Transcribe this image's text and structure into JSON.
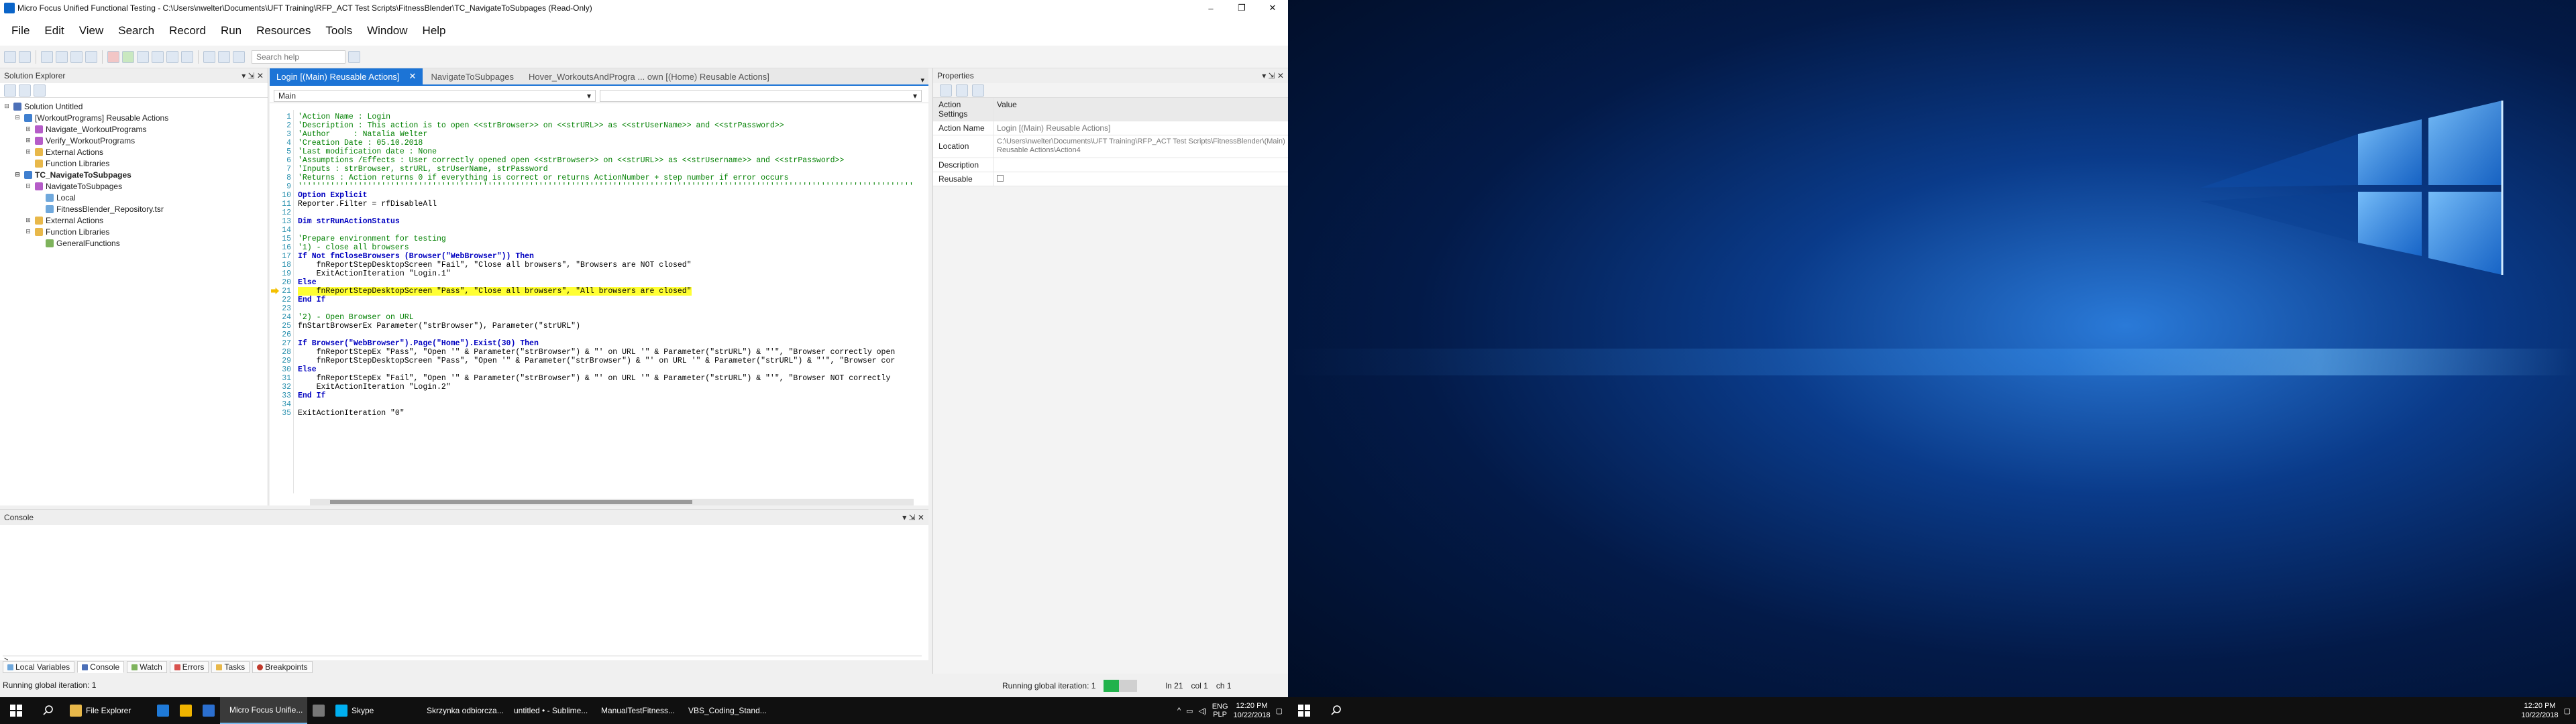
{
  "window": {
    "title": "Micro Focus Unified Functional Testing - C:\\Users\\nwelter\\Documents\\UFT Training\\RFP_ACT Test Scripts\\FitnessBlender\\TC_NavigateToSubpages (Read-Only)",
    "controls": [
      "–",
      "❐",
      "✕"
    ]
  },
  "menu": [
    "File",
    "Edit",
    "View",
    "Search",
    "Record",
    "Run",
    "Resources",
    "Tools",
    "Window",
    "Help"
  ],
  "toolbar": {
    "search_placeholder": "Search help"
  },
  "solution_explorer": {
    "title": "Solution Explorer",
    "controls": "▾ ⇲ ✕",
    "items": [
      {
        "label": "Solution Untitled",
        "level": 0,
        "icon": "solution-icon",
        "expand": "⊟"
      },
      {
        "label": "[WorkoutPrograms] Reusable Actions",
        "level": 1,
        "icon": "test-icon",
        "expand": "⊟"
      },
      {
        "label": "Navigate_WorkoutPrograms",
        "level": 2,
        "icon": "action-icon",
        "expand": "⊞"
      },
      {
        "label": "Verify_WorkoutPrograms",
        "level": 2,
        "icon": "action-icon",
        "expand": "⊞"
      },
      {
        "label": "External Actions",
        "level": 2,
        "icon": "folder-icon",
        "expand": "⊞"
      },
      {
        "label": "Function Libraries",
        "level": 2,
        "icon": "folder-icon",
        "expand": ""
      },
      {
        "label": "TC_NavigateToSubpages",
        "level": 1,
        "icon": "test-icon",
        "expand": "⊟",
        "bold": true
      },
      {
        "label": "NavigateToSubpages",
        "level": 2,
        "icon": "action-icon",
        "expand": "⊟"
      },
      {
        "label": "Local",
        "level": 3,
        "icon": "repository-icon",
        "expand": ""
      },
      {
        "label": "FitnessBlender_Repository.tsr",
        "level": 3,
        "icon": "repository-icon",
        "expand": ""
      },
      {
        "label": "External Actions",
        "level": 2,
        "icon": "folder-icon",
        "expand": "⊞"
      },
      {
        "label": "Function Libraries",
        "level": 2,
        "icon": "folder-icon",
        "expand": "⊟"
      },
      {
        "label": "GeneralFunctions",
        "level": 3,
        "icon": "library-icon",
        "expand": ""
      }
    ]
  },
  "editor": {
    "tabs": [
      {
        "label": "Login [(Main) Reusable Actions]",
        "active": true
      },
      {
        "label": "NavigateToSubpages",
        "active": false
      },
      {
        "label": "Hover_WorkoutsAndProgra ... own [(Home) Reusable Actions]",
        "active": false
      }
    ],
    "tab_menu_glyph": "▾",
    "scope": "Main",
    "lines": [
      {
        "n": "1",
        "t": "'Action Name : Login",
        "c": "com"
      },
      {
        "n": "2",
        "t": "'Description : This action is to open <<strBrowser>> on <<strURL>> as <<strUserName>> and <<strPassword>>",
        "c": "com"
      },
      {
        "n": "3",
        "t": "'Author     : Natalia Welter",
        "c": "com"
      },
      {
        "n": "4",
        "t": "'Creation Date : 05.10.2018",
        "c": "com"
      },
      {
        "n": "5",
        "t": "'Last modification date : None",
        "c": "com"
      },
      {
        "n": "6",
        "t": "'Assumptions /Effects : User correctly opened open <<strBrowser>> on <<strURL>> as <<strUsername>> and <<strPassword>>",
        "c": "com"
      },
      {
        "n": "7",
        "t": "'Inputs : strBrowser, strURL, strUserName, strPassword",
        "c": "com"
      },
      {
        "n": "8",
        "t": "'Returns : Action returns 0 if everything is correct or returns ActionNumber + step number if error occurs",
        "c": "com"
      },
      {
        "n": "9",
        "t": "'''''''''''''''''''''''''''''''''''''''''''''''''''''''''''''''''''''''''''''''''''''''''''''''''''''''''''''''''''''''''''''''''''''",
        "c": "com"
      },
      {
        "n": "10",
        "t": "Option Explicit",
        "c": "kw"
      },
      {
        "n": "11",
        "t": "Reporter.Filter = rfDisableAll",
        "c": "txt"
      },
      {
        "n": "12",
        "t": "",
        "c": "txt"
      },
      {
        "n": "13",
        "t": "Dim strRunActionStatus",
        "c": "kw"
      },
      {
        "n": "14",
        "t": "",
        "c": "txt"
      },
      {
        "n": "15",
        "t": "'Prepare environment for testing",
        "c": "com"
      },
      {
        "n": "16",
        "t": "'1) - close all browsers",
        "c": "com"
      },
      {
        "n": "17",
        "t": "If Not fnCloseBrowsers (Browser(\"WebBrowser\")) Then",
        "c": "kw"
      },
      {
        "n": "18",
        "t": "    fnReportStepDesktopScreen \"Fail\", \"Close all browsers\", \"Browsers are NOT closed\"",
        "c": "txt"
      },
      {
        "n": "19",
        "t": "    ExitActionIteration \"Login.1\"",
        "c": "txt"
      },
      {
        "n": "20",
        "t": "Else",
        "c": "kw"
      },
      {
        "n": "21",
        "t": "    fnReportStepDesktopScreen \"Pass\", \"Close all browsers\", \"All browsers are closed\"",
        "c": "hl"
      },
      {
        "n": "22",
        "t": "End If",
        "c": "kw"
      },
      {
        "n": "23",
        "t": "",
        "c": "txt"
      },
      {
        "n": "24",
        "t": "'2) - Open Browser on URL",
        "c": "com"
      },
      {
        "n": "25",
        "t": "fnStartBrowserEx Parameter(\"strBrowser\"), Parameter(\"strURL\")",
        "c": "txt"
      },
      {
        "n": "26",
        "t": "",
        "c": "txt"
      },
      {
        "n": "27",
        "t": "If Browser(\"WebBrowser\").Page(\"Home\").Exist(30) Then",
        "c": "kw"
      },
      {
        "n": "28",
        "t": "    fnReportStepEx \"Pass\", \"Open '\" & Parameter(\"strBrowser\") & \"' on URL '\" & Parameter(\"strURL\") & \"'\", \"Browser correctly open",
        "c": "txt"
      },
      {
        "n": "29",
        "t": "    fnReportStepDesktopScreen \"Pass\", \"Open '\" & Parameter(\"strBrowser\") & \"' on URL '\" & Parameter(\"strURL\") & \"'\", \"Browser cor",
        "c": "txt"
      },
      {
        "n": "30",
        "t": "Else",
        "c": "kw"
      },
      {
        "n": "31",
        "t": "    fnReportStepEx \"Fail\", \"Open '\" & Parameter(\"strBrowser\") & \"' on URL '\" & Parameter(\"strURL\") & \"'\", \"Browser NOT correctly",
        "c": "txt"
      },
      {
        "n": "32",
        "t": "    ExitActionIteration \"Login.2\"",
        "c": "txt"
      },
      {
        "n": "33",
        "t": "End If",
        "c": "kw"
      },
      {
        "n": "34",
        "t": "",
        "c": "txt"
      },
      {
        "n": "35",
        "t": "ExitActionIteration \"0\"",
        "c": "txt"
      }
    ]
  },
  "properties": {
    "title": "Properties",
    "controls": "▾ ⇲ ✕",
    "header": {
      "k": "Action Settings",
      "v": "Value"
    },
    "rows": [
      {
        "k": "Action Name",
        "v": "Login [(Main) Reusable Actions]"
      },
      {
        "k": "Location",
        "v": "C:\\Users\\nwelter\\Documents\\UFT Training\\RFP_ACT Test Scripts\\FitnessBlender\\(Main) Reusable Actions\\Action4"
      },
      {
        "k": "Description",
        "v": ""
      },
      {
        "k": "Reusable",
        "v": ""
      }
    ]
  },
  "console": {
    "title": "Console",
    "controls": "▾ ⇲ ✕",
    "prompt": ">"
  },
  "bottom_tabs": [
    "Local Variables",
    "Console",
    "Watch",
    "Errors",
    "Tasks",
    "Breakpoints"
  ],
  "status": {
    "left": "Running global iteration: 1",
    "right_label": "Running global iteration: 1",
    "progress": 0.45,
    "ln": "ln 21",
    "col": "col 1",
    "ch": "ch 1"
  },
  "taskbar_left": {
    "apps": [
      {
        "label": "File Explorer",
        "color": "#e8b84a",
        "active": false
      },
      {
        "label": "",
        "color": "#1f7ad8",
        "active": false
      },
      {
        "label": "",
        "color": "#f0b400",
        "active": false
      },
      {
        "label": "",
        "color": "#2b6fcf",
        "active": false
      },
      {
        "label": "Micro Focus Unifie...",
        "color": "#3a9ad9",
        "active": true
      },
      {
        "label": "",
        "color": "#777777",
        "active": false
      },
      {
        "label": "Skype",
        "color": "#00aff0",
        "active": false
      },
      {
        "label": "Skrzynka odbiorcza...",
        "color": "#0f6cbd",
        "active": false
      },
      {
        "label": "untitled • - Sublime...",
        "color": "#ff9800",
        "active": false
      },
      {
        "label": "ManualTestFitness...",
        "color": "#1e73be",
        "active": false
      },
      {
        "label": "VBS_Coding_Stand...",
        "color": "#2b579a",
        "active": false
      }
    ],
    "tray": {
      "lang": "ENG",
      "kb": "PLP",
      "time": "12:20 PM",
      "date": "10/22/2018"
    }
  },
  "taskbar_right": {
    "time": "12:20 PM",
    "date": "10/22/2018"
  },
  "colors": {
    "accent": "#1c74d6",
    "highlight": "#ffff33",
    "progress": "#21b24b"
  }
}
